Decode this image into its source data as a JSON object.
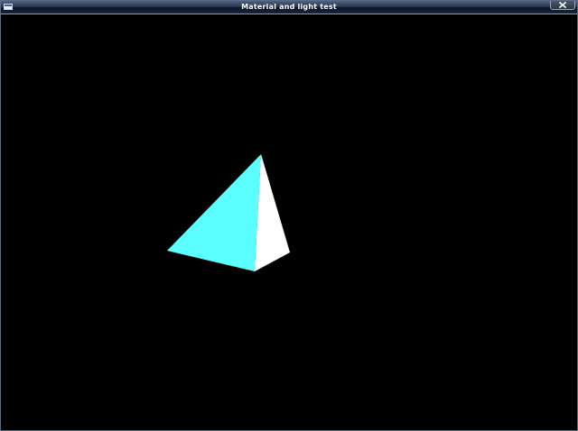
{
  "window": {
    "title": "Material and light test",
    "close_icon": "close-icon"
  },
  "scene": {
    "object": "pyramid",
    "background_color": "#000000",
    "faces": [
      {
        "name": "lit-face",
        "color": "#5cffff"
      },
      {
        "name": "side-face",
        "color": "#ffffff"
      },
      {
        "name": "shaded-side-face",
        "color": "#f4f4f4"
      }
    ]
  }
}
